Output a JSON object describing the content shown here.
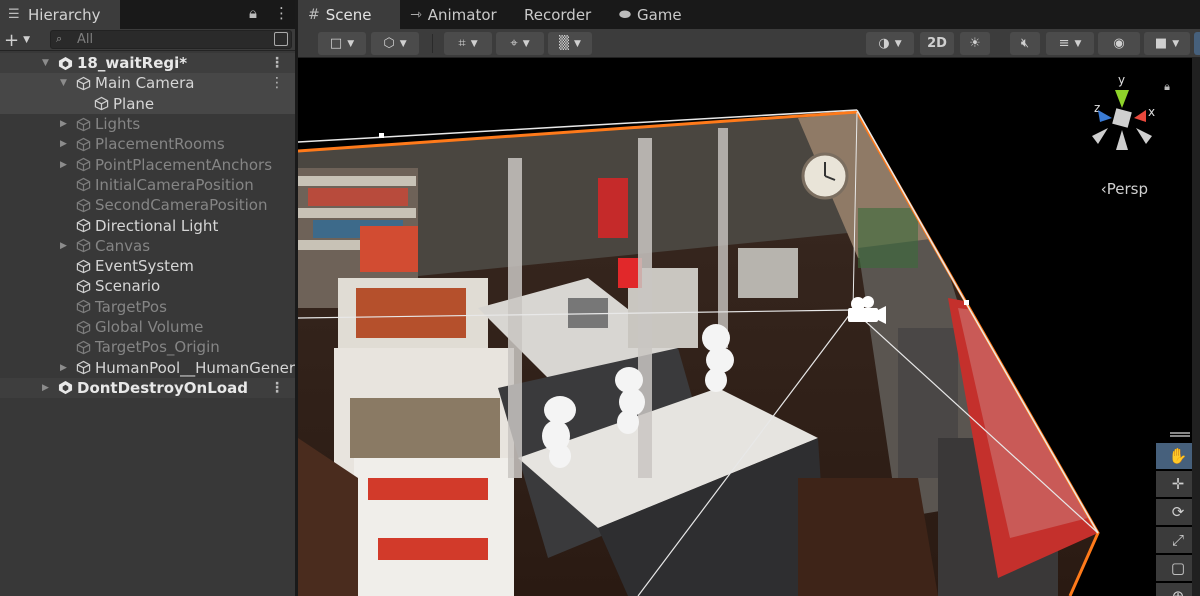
{
  "hierarchy": {
    "tab_label": "Hierarchy",
    "tab_icon": "list-icon",
    "search_placeholder": "All",
    "items": [
      {
        "label": "18_waitRegi*",
        "kind": "scene",
        "state": "expanded"
      },
      {
        "label": "Main Camera",
        "kind": "object",
        "state": "expanded",
        "active": true
      },
      {
        "label": "Plane",
        "kind": "object",
        "state": "leaf",
        "active": true
      },
      {
        "label": "Lights",
        "kind": "object",
        "state": "collapsed",
        "active": false
      },
      {
        "label": "PlacementRooms",
        "kind": "object",
        "state": "collapsed",
        "active": false
      },
      {
        "label": "PointPlacementAnchors",
        "kind": "object",
        "state": "collapsed",
        "active": false
      },
      {
        "label": "InitialCameraPosition",
        "kind": "object",
        "state": "leaf",
        "active": false
      },
      {
        "label": "SecondCameraPosition",
        "kind": "object",
        "state": "leaf",
        "active": false
      },
      {
        "label": "Directional Light",
        "kind": "object",
        "state": "leaf",
        "active": true
      },
      {
        "label": "Canvas",
        "kind": "object",
        "state": "collapsed",
        "active": false
      },
      {
        "label": "EventSystem",
        "kind": "object",
        "state": "leaf",
        "active": true
      },
      {
        "label": "Scenario",
        "kind": "object",
        "state": "leaf",
        "active": true
      },
      {
        "label": "TargetPos",
        "kind": "object",
        "state": "leaf",
        "active": false
      },
      {
        "label": "Global Volume",
        "kind": "object",
        "state": "leaf",
        "active": false
      },
      {
        "label": "TargetPos_Origin",
        "kind": "object",
        "state": "leaf",
        "active": false
      },
      {
        "label": "HumanPool__HumanGener",
        "kind": "object",
        "state": "collapsed",
        "active": true
      },
      {
        "label": "DontDestroyOnLoad",
        "kind": "scene",
        "state": "collapsed"
      }
    ]
  },
  "scene_tabs": [
    {
      "label": "Scene",
      "icon": "grid-icon",
      "active": true
    },
    {
      "label": "Animator",
      "icon": "animator-icon",
      "active": false
    },
    {
      "label": "Recorder",
      "icon": "",
      "active": false
    },
    {
      "label": "Game",
      "icon": "gamepad-icon",
      "active": false
    }
  ],
  "toolbar": {
    "mode_2d_label": "2D"
  },
  "viewport": {
    "projection_label": "‹Persp",
    "gizmo_axes": {
      "y": "y",
      "x": "x",
      "z": "z"
    },
    "colors": {
      "frustum": "#ff7a1a",
      "axis_y": "#8fd42a",
      "axis_x": "#e8483c",
      "axis_z": "#3a7bd5"
    }
  },
  "tools": [
    {
      "name": "hand-tool",
      "glyph": "✋",
      "active": true
    },
    {
      "name": "move-tool",
      "glyph": "✛",
      "active": false
    },
    {
      "name": "rotate-tool",
      "glyph": "⟳",
      "active": false
    },
    {
      "name": "scale-tool",
      "glyph": "⤢",
      "active": false
    },
    {
      "name": "rect-tool",
      "glyph": "▢",
      "active": false
    },
    {
      "name": "transform-tool",
      "glyph": "⊕",
      "active": false
    }
  ]
}
